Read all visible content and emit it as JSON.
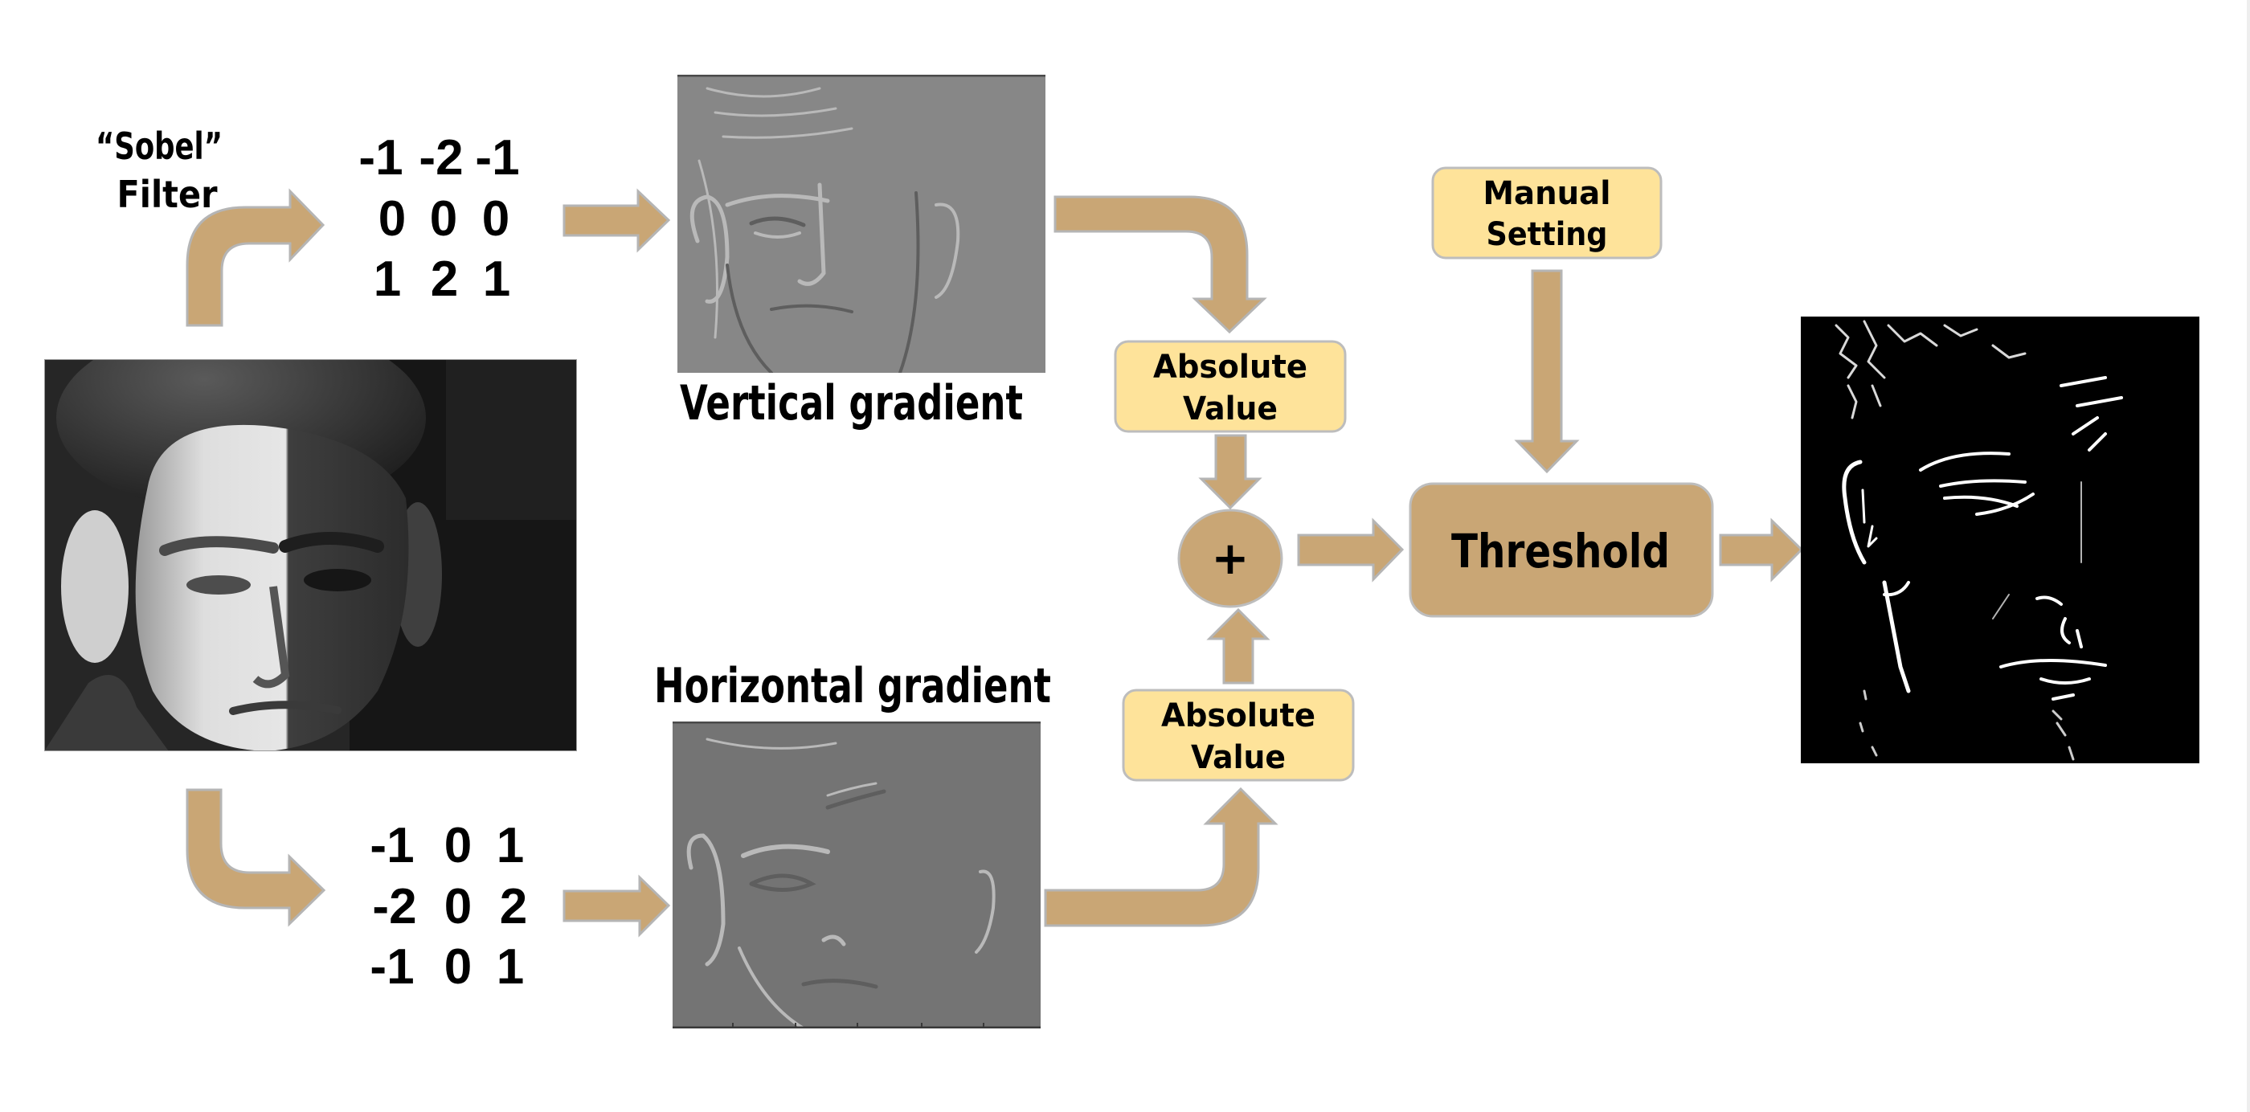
{
  "diagram": {
    "filter_label": {
      "line1": "“Sobel”",
      "line2": "Filter"
    },
    "kernels": {
      "vertical": [
        [
          -1,
          -2,
          -1
        ],
        [
          0,
          0,
          0
        ],
        [
          1,
          2,
          1
        ]
      ],
      "horizontal": [
        [
          -1,
          0,
          1
        ],
        [
          -2,
          0,
          2
        ],
        [
          -1,
          0,
          1
        ]
      ]
    },
    "image_labels": {
      "vertical_gradient": "Vertical gradient",
      "horizontal_gradient": "Horizontal gradient"
    },
    "images": {
      "input": "input-face-photo",
      "vertical_gradient": "vertical-gradient-image",
      "horizontal_gradient": "horizontal-gradient-image",
      "output": "thresholded-edge-image"
    },
    "nodes": {
      "abs_top": {
        "line1": "Absolute",
        "line2": "Value"
      },
      "abs_bottom": {
        "line1": "Absolute",
        "line2": "Value"
      },
      "sum": {
        "symbol": "+"
      },
      "manual_setting": {
        "line1": "Manual",
        "line2": "Setting"
      },
      "threshold": {
        "label": "Threshold"
      }
    },
    "colors": {
      "arrow": "#C9A675",
      "arrow_border": "#B5B5B5",
      "box_fill": "#FEE39A",
      "box_border": "#BDBDBD",
      "text": "#000000"
    }
  }
}
